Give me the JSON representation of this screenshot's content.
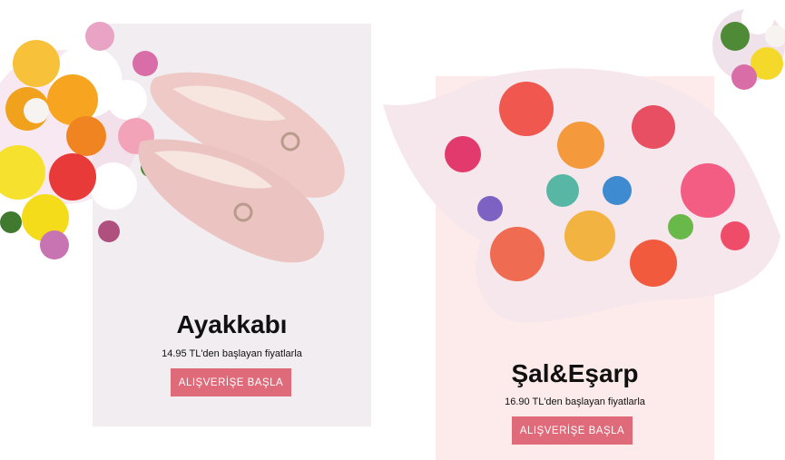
{
  "cards": [
    {
      "title": "Ayakkabı",
      "subtitle": "14.95 TL'den başlayan fiyatlarla",
      "button_label": "ALIŞVERİŞE BAŞLA"
    },
    {
      "title": "Şal&Eşarp",
      "subtitle": "16.90 TL'den başlayan fiyatlarla",
      "button_label": "ALIŞVERİŞE BAŞLA"
    }
  ],
  "colors": {
    "card_1_bg": "#f2edf0",
    "card_2_bg": "#fcebea",
    "button_bg": "#df6a79",
    "button_text": "#ffffff"
  },
  "images": {
    "flowers_icon": "flower-bouquet",
    "shoes_icon": "pink-loafers",
    "scarf_icon": "floral-scarf"
  }
}
